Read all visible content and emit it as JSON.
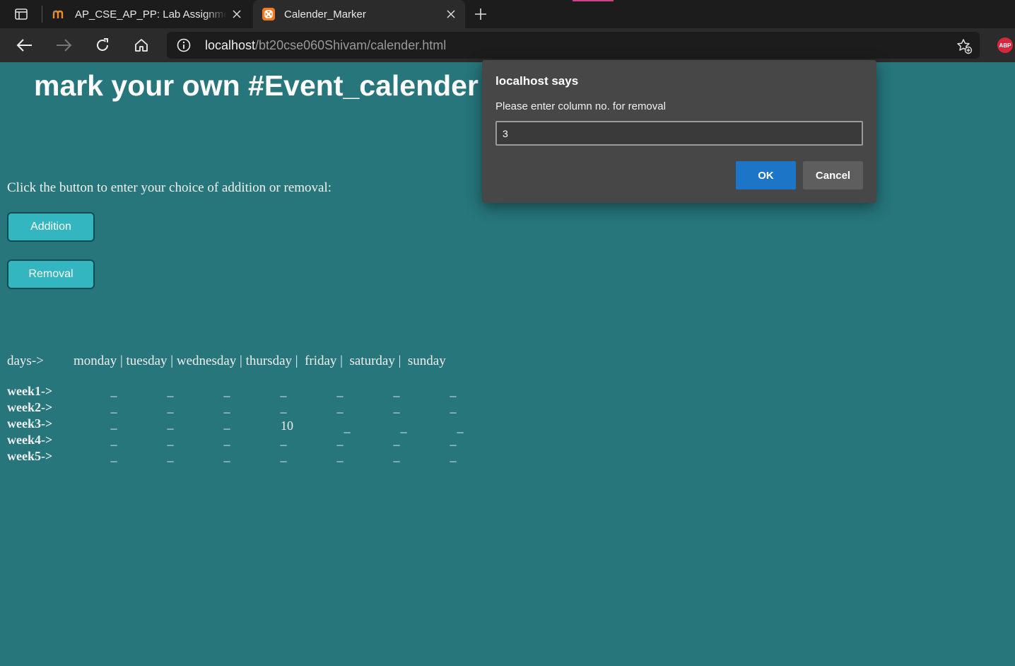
{
  "browser": {
    "tabs": [
      {
        "title": "AP_CSE_AP_PP: Lab Assignment"
      },
      {
        "title": "Calender_Marker"
      }
    ],
    "address": {
      "host": "localhost",
      "path": "/bt20cse060Shivam/calender.html"
    },
    "extension_badge": "ABP"
  },
  "page": {
    "title": "mark your own #Event_calender",
    "instruction": "Click the button to enter your choice of addition or removal:",
    "buttons": {
      "addition": "Addition",
      "removal": "Removal"
    },
    "calendar": {
      "days_label": "days->",
      "days_header": "monday | tuesday | wednesday | thursday |  friday |  saturday |  sunday",
      "weeks": [
        {
          "label": "week1->",
          "cells": [
            "_",
            "_",
            "_",
            "_",
            "_",
            "_",
            "_"
          ]
        },
        {
          "label": "week2->",
          "cells": [
            "_",
            "_",
            "_",
            "_",
            "_",
            "_",
            "_"
          ]
        },
        {
          "label": "week3->",
          "cells": [
            "_",
            "_",
            "_",
            "10",
            "_",
            "_",
            "_"
          ]
        },
        {
          "label": "week4->",
          "cells": [
            "_",
            "_",
            "_",
            "_",
            "_",
            "_",
            "_"
          ]
        },
        {
          "label": "week5->",
          "cells": [
            "_",
            "_",
            "_",
            "_",
            "_",
            "_",
            "_"
          ]
        }
      ]
    }
  },
  "dialog": {
    "title": "localhost says",
    "message": "Please enter column no. for removal",
    "input_value": "3",
    "ok_label": "OK",
    "cancel_label": "Cancel"
  },
  "colors": {
    "page_background": "#26767c",
    "button_background": "#34b6c1",
    "dialog_background": "#474747",
    "ok_button": "#1c75c7",
    "abp_badge": "#d8263d"
  }
}
